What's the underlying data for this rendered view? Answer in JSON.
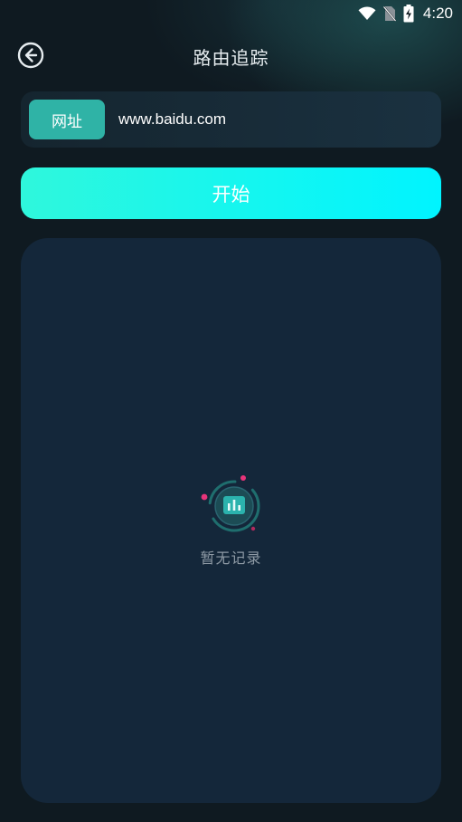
{
  "status_bar": {
    "time": "4:20",
    "icons": [
      "wifi-icon",
      "no-sim-icon",
      "battery-charging-icon"
    ]
  },
  "header": {
    "title": "路由追踪",
    "back_icon": "back-arrow-circle-icon"
  },
  "url_row": {
    "label": "网址",
    "value": "www.baidu.com"
  },
  "start_button": {
    "label": "开始"
  },
  "results": {
    "empty_icon": "empty-records-chart-icon",
    "empty_text": "暂无记录"
  },
  "colors": {
    "background": "#0f1a21",
    "accent_teal": "#2fb3a6",
    "button_gradient_start": "#2ff7dc",
    "button_gradient_end": "#00f4ff",
    "panel": "#14273a",
    "empty_text": "#8e9aa5",
    "dot_pink": "#e8347a"
  }
}
